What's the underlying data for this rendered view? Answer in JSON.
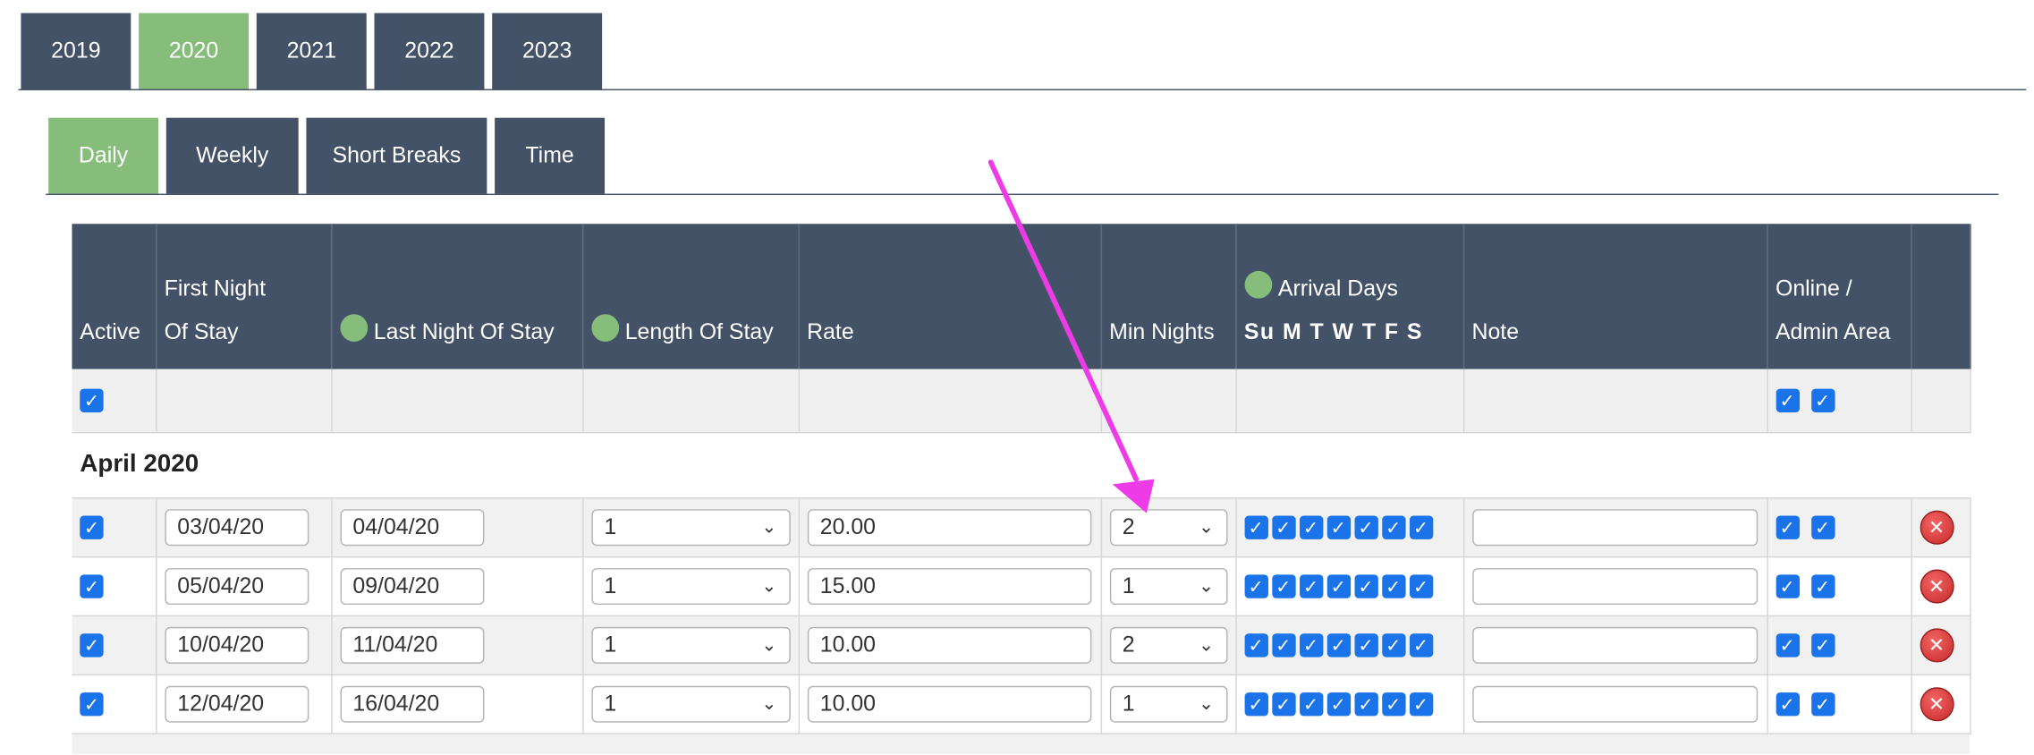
{
  "year_tabs": [
    {
      "label": "2019",
      "active": false
    },
    {
      "label": "2020",
      "active": true
    },
    {
      "label": "2021",
      "active": false
    },
    {
      "label": "2022",
      "active": false
    },
    {
      "label": "2023",
      "active": false
    }
  ],
  "type_tabs": [
    {
      "label": "Daily",
      "active": true
    },
    {
      "label": "Weekly",
      "active": false
    },
    {
      "label": "Short Breaks",
      "active": false
    },
    {
      "label": "Time",
      "active": false
    }
  ],
  "table": {
    "headers": {
      "active": "Active",
      "first_night_line1": "First Night",
      "first_night_line2": "Of Stay",
      "last_night": "Last Night Of Stay",
      "length": "Length Of Stay",
      "rate": "Rate",
      "min_nights": "Min Nights",
      "arrival_days": "Arrival Days",
      "arrival_days_letters": "Su M T W T F S",
      "note": "Note",
      "online_line1": "Online /",
      "online_line2": "Admin Area"
    },
    "help_icon_glyph": "?",
    "month_label": "April 2020",
    "rows": [
      {
        "first": "03/04/20",
        "last": "04/04/20",
        "length": "1",
        "rate": "20.00",
        "min": "2",
        "note": ""
      },
      {
        "first": "05/04/20",
        "last": "09/04/20",
        "length": "1",
        "rate": "15.00",
        "min": "1",
        "note": ""
      },
      {
        "first": "10/04/20",
        "last": "11/04/20",
        "length": "1",
        "rate": "10.00",
        "min": "2",
        "note": ""
      },
      {
        "first": "12/04/20",
        "last": "16/04/20",
        "length": "1",
        "rate": "10.00",
        "min": "1",
        "note": ""
      }
    ]
  },
  "colors": {
    "header_bg": "#435266",
    "active_tab": "#86bd7a",
    "checkbox": "#1a73e8",
    "annotation_arrow": "#ee3be8"
  },
  "glyphs": {
    "check": "✓",
    "chevron": "⌄",
    "delete": "✕"
  }
}
